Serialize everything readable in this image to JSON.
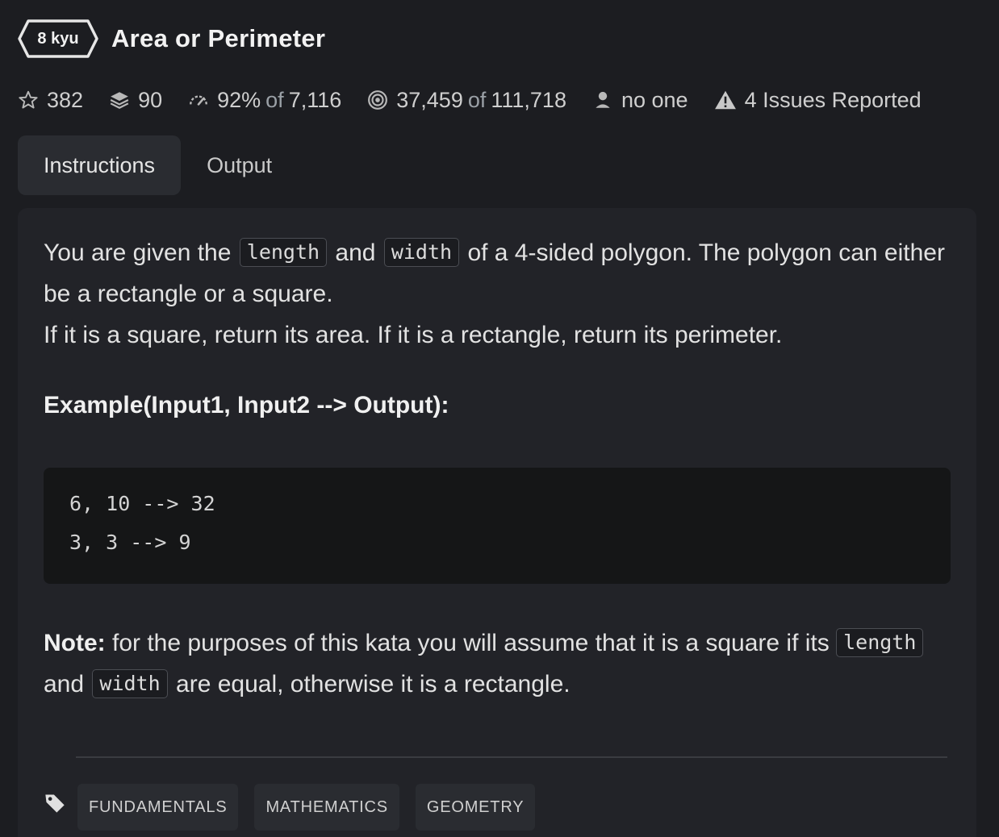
{
  "header": {
    "kyu": "8 kyu",
    "title": "Area or Perimeter"
  },
  "stats": {
    "stars": "382",
    "collections": "90",
    "satisfaction_percent": "92%",
    "satisfaction_of": "of",
    "satisfaction_votes": "7,116",
    "completed": "37,459",
    "completed_of": "of",
    "attempts": "111,718",
    "author": "no one",
    "issues": "4 Issues Reported"
  },
  "tabs": [
    "Instructions",
    "Output"
  ],
  "instructions": {
    "p1_a": "You are given the",
    "code_length": "length",
    "p1_and": "and",
    "code_width": "width",
    "p1_b": "of a 4-sided polygon. The polygon can either be a rectangle or a square.",
    "p2": "If it is a square, return its area. If it is a rectangle, return its perimeter.",
    "example_heading": "Example(Input1, Input2 --> Output):",
    "examples": [
      "6, 10 --> 32",
      "3, 3 --> 9"
    ],
    "note_label": "Note:",
    "note_a": "for the purposes of this kata you will assume that it is a square if its",
    "note_and": "and",
    "note_b": "are equal, otherwise it is a rectangle."
  },
  "tags": [
    "FUNDAMENTALS",
    "MATHEMATICS",
    "GEOMETRY"
  ],
  "icons": {
    "star": "star-icon",
    "collections": "layers-icon",
    "satisfaction": "gauge-icon",
    "completed": "target-icon",
    "author": "user-icon",
    "issues": "warning-icon",
    "tag": "tag-icon"
  }
}
